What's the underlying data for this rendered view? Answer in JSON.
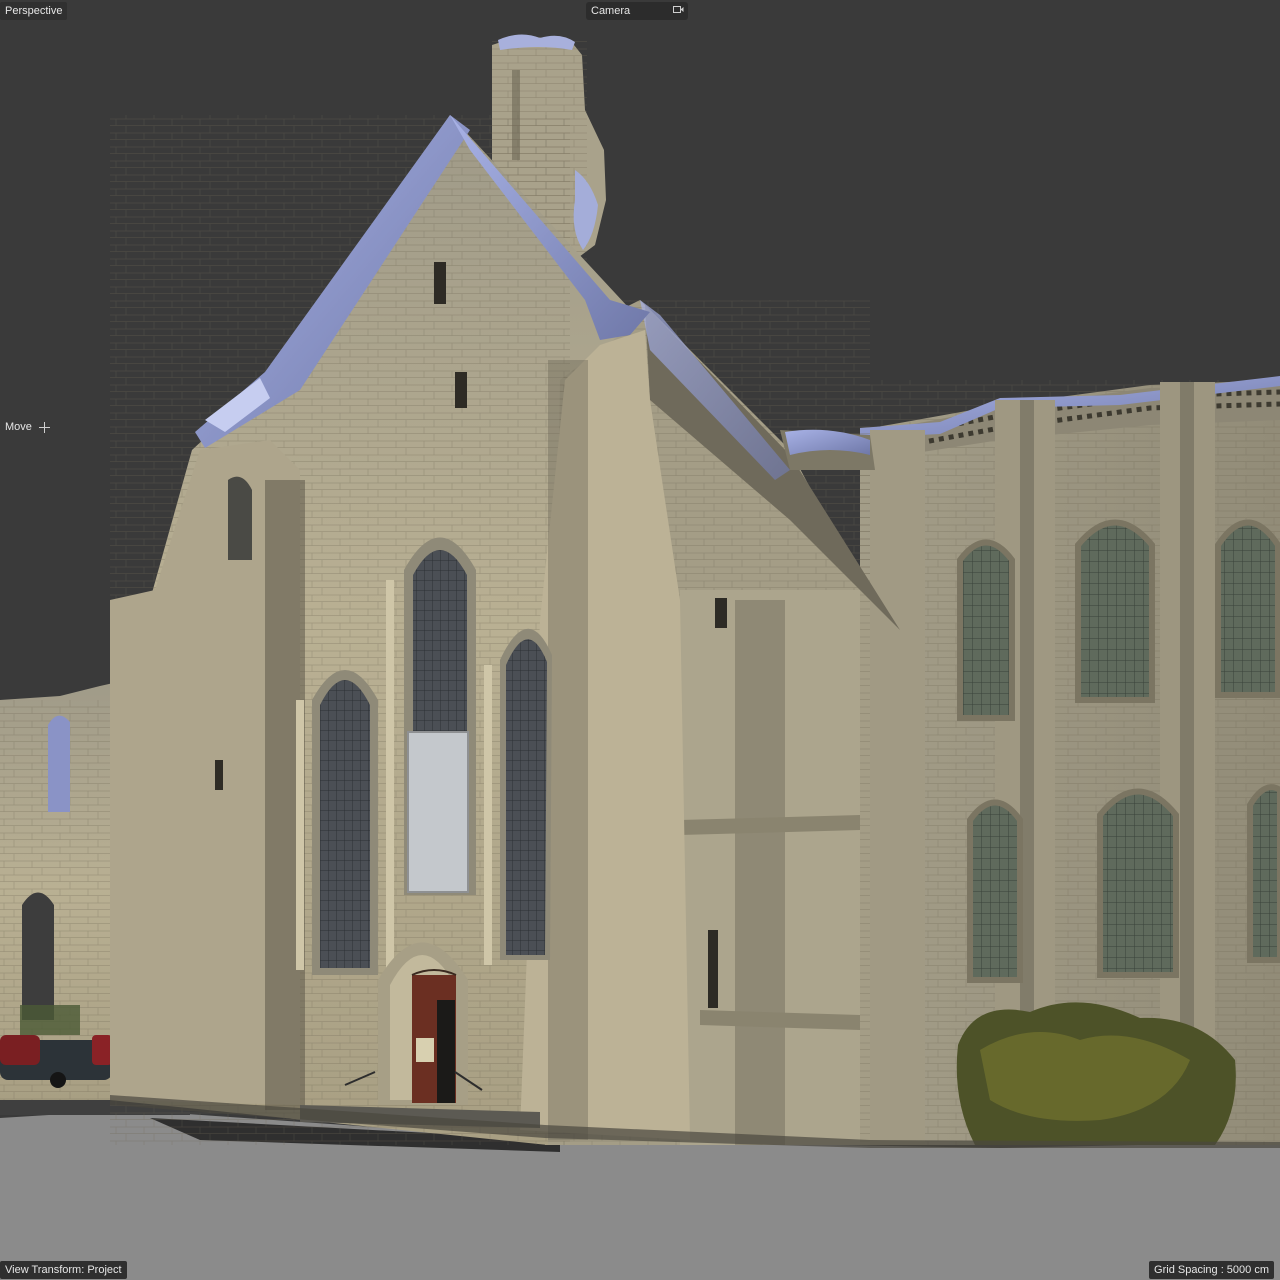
{
  "viewport": {
    "view_label": "Perspective",
    "camera_label": "Camera",
    "tool_label": "Move",
    "view_transform": "View Transform: Project",
    "grid_spacing": "Grid Spacing : 5000 cm"
  },
  "colors": {
    "background": "#3a3a3a",
    "ground": "#8a8a8a",
    "stone": "#b8ae92",
    "roof": "#8f9bd2"
  },
  "icons": [
    "camera-icon",
    "move-gizmo-icon"
  ]
}
